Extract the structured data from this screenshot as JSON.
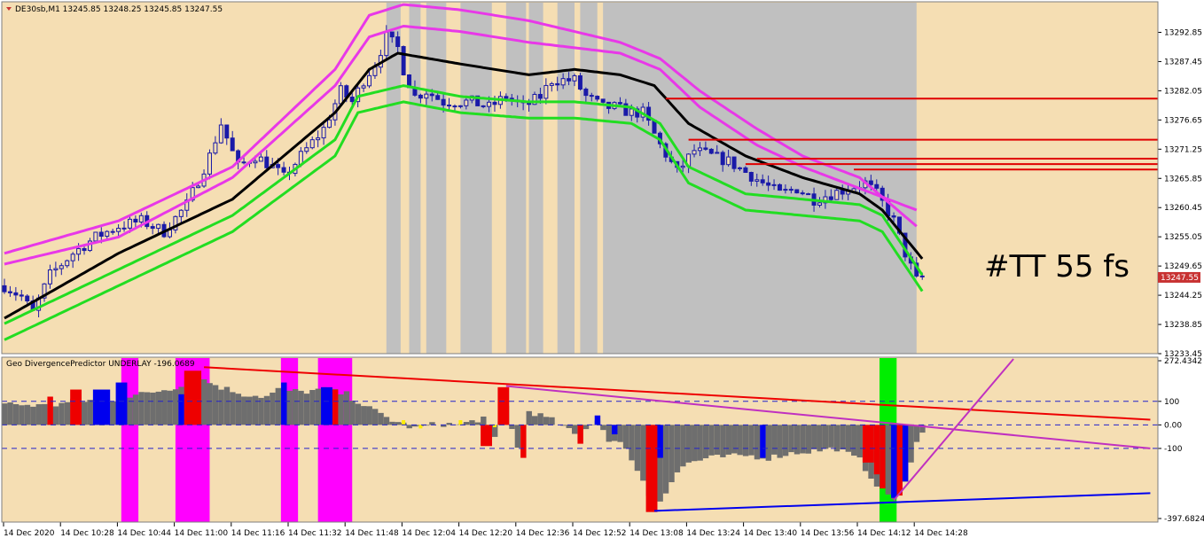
{
  "window": {
    "symbol_header": "DE30sb,M1  13245.85 13248.25 13245.85 13247.55"
  },
  "annotation": {
    "text": "#TT 55 fs"
  },
  "colors": {
    "background": "#f5deb3",
    "session_band": "#c0c0c0",
    "candle": "#1a1aa8",
    "sma": "#000000",
    "envelope_green": "#22dd22",
    "envelope_magenta": "#e838e8",
    "level_lines": "#e00000",
    "osc_gray": "#6e6e6e",
    "osc_red": "#ee0000",
    "osc_blue": "#0000ee",
    "osc_yellow": "#ffee00",
    "osc_highlight_magenta": "#ff00ff",
    "osc_highlight_green": "#00ee00",
    "trend_red": "#ee0000",
    "trend_magenta": "#c030c0",
    "trend_blue": "#0000ee",
    "price_tag": "#c83232"
  },
  "chart_data": [
    {
      "type": "candlestick",
      "title": "DE30sb,M1  13245.85 13248.25 13245.85 13247.55",
      "ylim": [
        13233.45,
        13298.5
      ],
      "y_ticks": [
        "13292.85",
        "13287.45",
        "13282.05",
        "13276.65",
        "13271.25",
        "13265.85",
        "13260.45",
        "13255.05",
        "13249.65",
        "13244.25",
        "13238.85",
        "13233.45"
      ],
      "current_price": "13247.55",
      "price_path": [
        [
          0,
          13246
        ],
        [
          3,
          13244
        ],
        [
          5,
          13241
        ],
        [
          8,
          13248
        ],
        [
          12,
          13252
        ],
        [
          16,
          13255
        ],
        [
          20,
          13257
        ],
        [
          24,
          13258
        ],
        [
          28,
          13256
        ],
        [
          32,
          13261
        ],
        [
          36,
          13270
        ],
        [
          38,
          13276
        ],
        [
          41,
          13268
        ],
        [
          44,
          13270
        ],
        [
          47,
          13268
        ],
        [
          49,
          13266
        ],
        [
          52,
          13270
        ],
        [
          56,
          13275
        ],
        [
          59,
          13282
        ],
        [
          61,
          13280
        ],
        [
          63,
          13284
        ],
        [
          65,
          13287
        ],
        [
          67,
          13292
        ],
        [
          69,
          13290
        ],
        [
          70,
          13286
        ],
        [
          72,
          13281
        ],
        [
          74,
          13282
        ],
        [
          77,
          13280
        ],
        [
          79,
          13280
        ],
        [
          82,
          13280
        ],
        [
          85,
          13279
        ],
        [
          88,
          13281
        ],
        [
          91,
          13279
        ],
        [
          94,
          13281
        ],
        [
          96,
          13284
        ],
        [
          98,
          13284
        ],
        [
          100,
          13284
        ],
        [
          102,
          13281
        ],
        [
          105,
          13279
        ],
        [
          107,
          13279
        ],
        [
          110,
          13278
        ],
        [
          112,
          13278
        ],
        [
          115,
          13272
        ],
        [
          118,
          13267
        ],
        [
          121,
          13271
        ],
        [
          124,
          13270
        ],
        [
          127,
          13269
        ],
        [
          130,
          13267
        ],
        [
          133,
          13265
        ],
        [
          136,
          13263
        ],
        [
          139,
          13264
        ],
        [
          142,
          13262
        ],
        [
          145,
          13263
        ],
        [
          148,
          13264
        ],
        [
          151,
          13265
        ],
        [
          153,
          13263
        ],
        [
          156,
          13258
        ],
        [
          158,
          13252
        ],
        [
          160,
          13247
        ],
        [
          161,
          13247.5
        ]
      ],
      "sma": [
        [
          0,
          13240
        ],
        [
          20,
          13252
        ],
        [
          40,
          13262
        ],
        [
          58,
          13278
        ],
        [
          64,
          13286
        ],
        [
          69,
          13289
        ],
        [
          80,
          13287
        ],
        [
          92,
          13285
        ],
        [
          100,
          13286
        ],
        [
          108,
          13285
        ],
        [
          114,
          13283
        ],
        [
          120,
          13276
        ],
        [
          130,
          13270
        ],
        [
          140,
          13266
        ],
        [
          150,
          13263
        ],
        [
          154,
          13260
        ],
        [
          161,
          13251
        ]
      ],
      "envelope_green_inner": [
        [
          0,
          13239
        ],
        [
          20,
          13249
        ],
        [
          40,
          13259
        ],
        [
          58,
          13273
        ],
        [
          62,
          13281
        ],
        [
          70,
          13283
        ],
        [
          80,
          13281
        ],
        [
          92,
          13280
        ],
        [
          100,
          13280
        ],
        [
          110,
          13279
        ],
        [
          115,
          13276
        ],
        [
          120,
          13268
        ],
        [
          130,
          13263
        ],
        [
          140,
          13262
        ],
        [
          150,
          13261
        ],
        [
          154,
          13259
        ],
        [
          161,
          13248
        ]
      ],
      "envelope_green_outer": [
        [
          0,
          13236
        ],
        [
          20,
          13246
        ],
        [
          40,
          13256
        ],
        [
          58,
          13270
        ],
        [
          62,
          13278
        ],
        [
          70,
          13280
        ],
        [
          80,
          13278
        ],
        [
          92,
          13277
        ],
        [
          100,
          13277
        ],
        [
          110,
          13276
        ],
        [
          115,
          13273
        ],
        [
          120,
          13265
        ],
        [
          130,
          13260
        ],
        [
          140,
          13259
        ],
        [
          150,
          13258
        ],
        [
          154,
          13256
        ],
        [
          161,
          13245
        ]
      ],
      "envelope_magenta_inner": [
        [
          0,
          13250
        ],
        [
          20,
          13255
        ],
        [
          40,
          13266
        ],
        [
          58,
          13283
        ],
        [
          64,
          13292
        ],
        [
          70,
          13294
        ],
        [
          80,
          13293
        ],
        [
          92,
          13291
        ],
        [
          100,
          13290
        ],
        [
          108,
          13289
        ],
        [
          115,
          13286
        ],
        [
          122,
          13279
        ],
        [
          132,
          13272
        ],
        [
          140,
          13268
        ],
        [
          150,
          13264
        ],
        [
          160,
          13260
        ]
      ],
      "envelope_magenta_outer": [
        [
          0,
          13252
        ],
        [
          20,
          13258
        ],
        [
          40,
          13268
        ],
        [
          58,
          13286
        ],
        [
          64,
          13296
        ],
        [
          70,
          13298
        ],
        [
          80,
          13297
        ],
        [
          92,
          13295
        ],
        [
          100,
          13293
        ],
        [
          108,
          13291
        ],
        [
          115,
          13288
        ],
        [
          122,
          13282
        ],
        [
          132,
          13275
        ],
        [
          140,
          13270
        ],
        [
          150,
          13266
        ],
        [
          160,
          13257
        ]
      ],
      "levels": [
        {
          "price": 13280.6,
          "from_bar": 116
        },
        {
          "price": 13273.0,
          "from_bar": 120
        },
        {
          "price": 13269.5,
          "from_bar": 132
        },
        {
          "price": 13268.5,
          "from_bar": 130
        },
        {
          "price": 13267.5,
          "from_bar": 149
        }
      ],
      "session_bands": [
        [
          67,
          69.5
        ],
        [
          71,
          73
        ],
        [
          74,
          77.5
        ],
        [
          80,
          85.5
        ],
        [
          88,
          91.5
        ],
        [
          92,
          94.5
        ],
        [
          97,
          100
        ],
        [
          101,
          104
        ],
        [
          105,
          160
        ]
      ]
    },
    {
      "type": "bar",
      "title": "Geo DivergencePredictor UNDERLAY -196.0689",
      "ylim": [
        -397.6824,
        272.4342
      ],
      "y_ticks": [
        "272.4342",
        "100",
        "0.00",
        "-100",
        "-397.6824"
      ],
      "highlight_bands": [
        {
          "from": 20.5,
          "to": 23.5,
          "color": "magenta"
        },
        {
          "from": 30,
          "to": 36,
          "color": "magenta"
        },
        {
          "from": 48.5,
          "to": 51.5,
          "color": "magenta"
        },
        {
          "from": 55,
          "to": 61,
          "color": "magenta"
        },
        {
          "from": 153.5,
          "to": 156.5,
          "color": "green"
        }
      ],
      "histogram_keys": [
        [
          0,
          90
        ],
        [
          8,
          80
        ],
        [
          12,
          100
        ],
        [
          20,
          110
        ],
        [
          26,
          140
        ],
        [
          30,
          160
        ],
        [
          33,
          200
        ],
        [
          34,
          240
        ],
        [
          35,
          190
        ],
        [
          38,
          160
        ],
        [
          42,
          130
        ],
        [
          46,
          120
        ],
        [
          48,
          150
        ],
        [
          52,
          140
        ],
        [
          56,
          150
        ],
        [
          60,
          130
        ],
        [
          64,
          70
        ],
        [
          68,
          20
        ],
        [
          72,
          -15
        ],
        [
          76,
          5
        ],
        [
          80,
          0
        ],
        [
          84,
          30
        ],
        [
          86,
          -60
        ],
        [
          88,
          80
        ],
        [
          90,
          -100
        ],
        [
          92,
          60
        ],
        [
          96,
          20
        ],
        [
          100,
          -40
        ],
        [
          104,
          20
        ],
        [
          106,
          -60
        ],
        [
          108,
          -80
        ],
        [
          110,
          -140
        ],
        [
          112,
          -240
        ],
        [
          114,
          -360
        ],
        [
          115,
          -320
        ],
        [
          118,
          -200
        ],
        [
          120,
          -160
        ],
        [
          124,
          -140
        ],
        [
          130,
          -130
        ],
        [
          134,
          -140
        ],
        [
          138,
          -120
        ],
        [
          142,
          -110
        ],
        [
          146,
          -100
        ],
        [
          150,
          -150
        ],
        [
          152,
          -220
        ],
        [
          154,
          -280
        ],
        [
          156,
          -310
        ],
        [
          158,
          -250
        ],
        [
          160,
          -80
        ],
        [
          161,
          -20
        ]
      ],
      "colored_bars": [
        {
          "from": 8,
          "to": 9,
          "color": "red",
          "value": 120
        },
        {
          "from": 12,
          "to": 14,
          "color": "red",
          "value": 150
        },
        {
          "from": 16,
          "to": 19,
          "color": "blue",
          "value": 150
        },
        {
          "from": 20,
          "to": 22,
          "color": "blue",
          "value": 180
        },
        {
          "from": 31,
          "to": 32,
          "color": "blue",
          "value": 130
        },
        {
          "from": 32,
          "to": 35,
          "color": "red",
          "value": 230
        },
        {
          "from": 49,
          "to": 50,
          "color": "blue",
          "value": 180
        },
        {
          "from": 56,
          "to": 58,
          "color": "blue",
          "value": 160
        },
        {
          "from": 58,
          "to": 59,
          "color": "red",
          "value": 150
        },
        {
          "from": 84,
          "to": 86,
          "color": "red",
          "value": -90
        },
        {
          "from": 87,
          "to": 89,
          "color": "red",
          "value": 160
        },
        {
          "from": 91,
          "to": 92,
          "color": "red",
          "value": -140
        },
        {
          "from": 101,
          "to": 102,
          "color": "red",
          "value": -80
        },
        {
          "from": 104,
          "to": 105,
          "color": "blue",
          "value": 40
        },
        {
          "from": 107,
          "to": 108,
          "color": "blue",
          "value": -40
        },
        {
          "from": 113,
          "to": 115,
          "color": "red",
          "value": -370
        },
        {
          "from": 115,
          "to": 116,
          "color": "blue",
          "value": -140
        },
        {
          "from": 133,
          "to": 134,
          "color": "blue",
          "value": -140
        },
        {
          "from": 151,
          "to": 153,
          "color": "red",
          "value": -160
        },
        {
          "from": 153,
          "to": 154,
          "color": "red",
          "value": -210
        },
        {
          "from": 154,
          "to": 155,
          "color": "red",
          "value": -270
        },
        {
          "from": 156,
          "to": 157,
          "color": "blue",
          "value": -310
        },
        {
          "from": 157,
          "to": 158,
          "color": "red",
          "value": -300
        },
        {
          "from": 158,
          "to": 159,
          "color": "blue",
          "value": -240
        }
      ],
      "yellow_bars": [
        [
          70,
          20
        ],
        [
          73,
          -15
        ],
        [
          80,
          20
        ],
        [
          86,
          -10
        ],
        [
          104,
          30
        ]
      ],
      "trend_lines": [
        {
          "color": "red",
          "points": [
            [
              35,
              245
            ],
            [
              201,
              22
            ]
          ]
        },
        {
          "color": "magenta",
          "points": [
            [
              88,
              165
            ],
            [
              201,
              -100
            ]
          ]
        },
        {
          "color": "blue",
          "points": [
            [
              114,
              -365
            ],
            [
              201,
              -290
            ]
          ]
        },
        {
          "color": "magenta",
          "points": [
            [
              156,
              -320
            ],
            [
              177,
              280
            ]
          ]
        }
      ]
    }
  ],
  "x_axis_labels": [
    "14 Dec 2020",
    "14 Dec 10:28",
    "14 Dec 10:44",
    "14 Dec 11:00",
    "14 Dec 11:16",
    "14 Dec 11:32",
    "14 Dec 11:48",
    "14 Dec 12:04",
    "14 Dec 12:20",
    "14 Dec 12:36",
    "14 Dec 12:52",
    "14 Dec 13:08",
    "14 Dec 13:24",
    "14 Dec 13:40",
    "14 Dec 13:56",
    "14 Dec 14:12",
    "14 Dec 14:28"
  ]
}
